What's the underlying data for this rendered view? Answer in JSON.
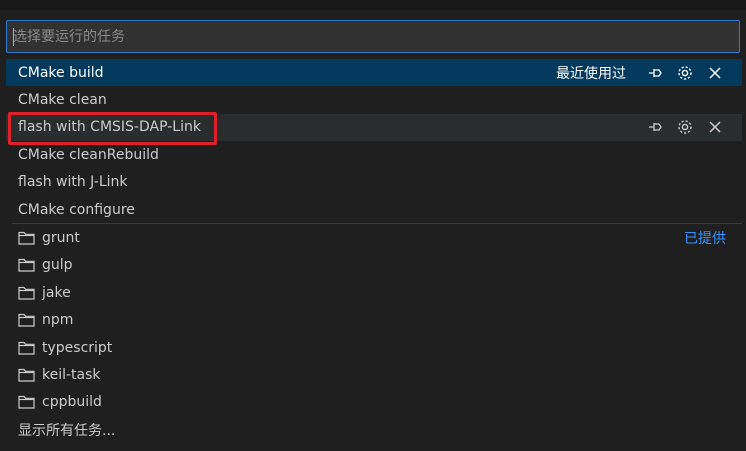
{
  "search": {
    "placeholder": "选择要运行的任务",
    "value": ""
  },
  "tasks": [
    {
      "label": "CMake build",
      "description": "最近使用过"
    },
    {
      "label": "CMake clean"
    },
    {
      "label": "flash with CMSIS-DAP-Link"
    },
    {
      "label": "CMake cleanRebuild"
    },
    {
      "label": "flash with J-Link"
    },
    {
      "label": "CMake configure"
    }
  ],
  "providers": {
    "provided_label": "已提供",
    "items": [
      "grunt",
      "gulp",
      "jake",
      "npm",
      "typescript",
      "keil-task",
      "cppbuild"
    ]
  },
  "show_all_label": "显示所有任务...",
  "icons": {
    "pin": "pin-icon",
    "gear": "gear-icon",
    "close": "close-icon",
    "folder": "folder-icon"
  },
  "colors": {
    "selected_bg": "#04395e",
    "hover_bg": "#2a2d2e",
    "focus_border": "#2b79d0",
    "link": "#3794ff",
    "annotation": "#e0202a"
  }
}
